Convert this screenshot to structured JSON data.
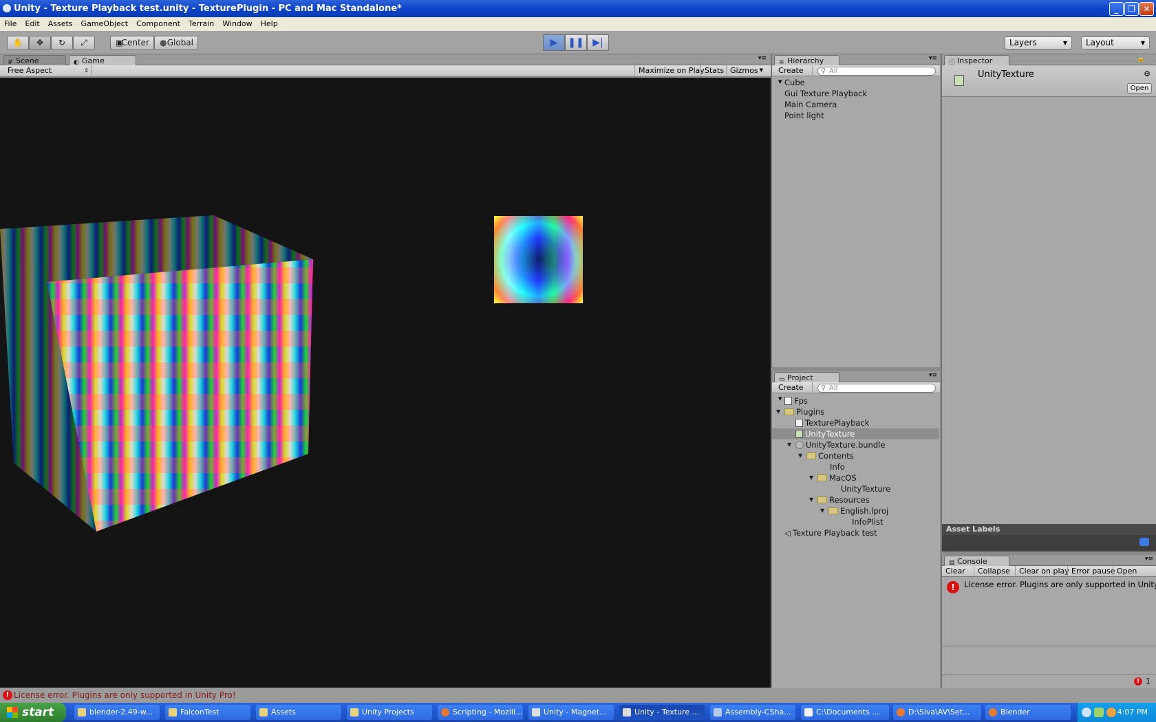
{
  "window": {
    "title": "Unity - Texture Playback test.unity - TexturePlugin - PC and Mac Standalone*"
  },
  "menu": [
    "File",
    "Edit",
    "Assets",
    "GameObject",
    "Component",
    "Terrain",
    "Window",
    "Help"
  ],
  "toolbar": {
    "pivot_label": "Center",
    "space_label": "Global",
    "layers_label": "Layers",
    "layout_label": "Layout",
    "play_active": true
  },
  "game_view": {
    "tabs": [
      "Scene",
      "Game"
    ],
    "active_tab": "Game",
    "aspect": "Free Aspect",
    "buttons": [
      "Maximize on Play",
      "Stats",
      "Gizmos"
    ],
    "background_color": "#141414"
  },
  "hierarchy": {
    "title": "Hierarchy",
    "create_label": "Create",
    "search_placeholder": "All",
    "items": [
      "Cube",
      "Gui Texture Playback",
      "Main Camera",
      "Point light"
    ]
  },
  "project": {
    "title": "Project",
    "create_label": "Create",
    "search_placeholder": "All",
    "items": [
      {
        "label": "Fps",
        "icon": "script-icon",
        "expand": false,
        "selected": false
      },
      {
        "label": "Plugins",
        "icon": "folder-icon",
        "expand": true,
        "selected": false
      },
      {
        "label": "TexturePlayback",
        "icon": "script-icon",
        "expand": false,
        "selected": false
      },
      {
        "label": "UnityTexture",
        "icon": "plugin-icon",
        "expand": false,
        "selected": true
      },
      {
        "label": "UnityTexture.bundle",
        "icon": "bundle-icon",
        "expand": true,
        "selected": false
      },
      {
        "label": "Contents",
        "icon": "folder-icon",
        "expand": true,
        "selected": false
      },
      {
        "label": "Info",
        "icon": "",
        "expand": false,
        "selected": false
      },
      {
        "label": "MacOS",
        "icon": "folder-icon",
        "expand": true,
        "selected": false
      },
      {
        "label": "UnityTexture",
        "icon": "",
        "expand": false,
        "selected": false
      },
      {
        "label": "Resources",
        "icon": "folder-icon",
        "expand": true,
        "selected": false
      },
      {
        "label": "English.lproj",
        "icon": "folder-icon",
        "expand": true,
        "selected": false
      },
      {
        "label": "InfoPlist",
        "icon": "",
        "expand": false,
        "selected": false
      },
      {
        "label": "Texture Playback test",
        "icon": "scene-icon",
        "expand": false,
        "selected": false
      }
    ]
  },
  "inspector": {
    "title": "Inspector",
    "object_name": "UnityTexture",
    "open_label": "Open",
    "asset_labels": "Asset Labels"
  },
  "console": {
    "title": "Console",
    "buttons": [
      "Clear",
      "Collapse",
      "Clear on play",
      "Error pause",
      "Open Editor"
    ],
    "message": "License error. Plugins are only supported in Unity Pro!",
    "error_count": "1"
  },
  "status": {
    "message": "License error. Plugins are only supported in Unity Pro!"
  },
  "taskbar": {
    "start_label": "start",
    "tasks": [
      {
        "label": "blender-2.49-w...",
        "active": false
      },
      {
        "label": "FalconTest",
        "active": false
      },
      {
        "label": "Assets",
        "active": false
      },
      {
        "label": "Unity Projects",
        "active": false
      },
      {
        "label": "Scripting - Mozill...",
        "active": false
      },
      {
        "label": "Unity - Magnet...",
        "active": false
      },
      {
        "label": "Unity - Texture ...",
        "active": true
      },
      {
        "label": "Assembly-CSha...",
        "active": false
      },
      {
        "label": "C:\\Documents ...",
        "active": false
      },
      {
        "label": "D:\\Siva\\AV\\Set...",
        "active": false
      },
      {
        "label": "Blender",
        "active": false
      }
    ],
    "clock": "4:07 PM"
  }
}
